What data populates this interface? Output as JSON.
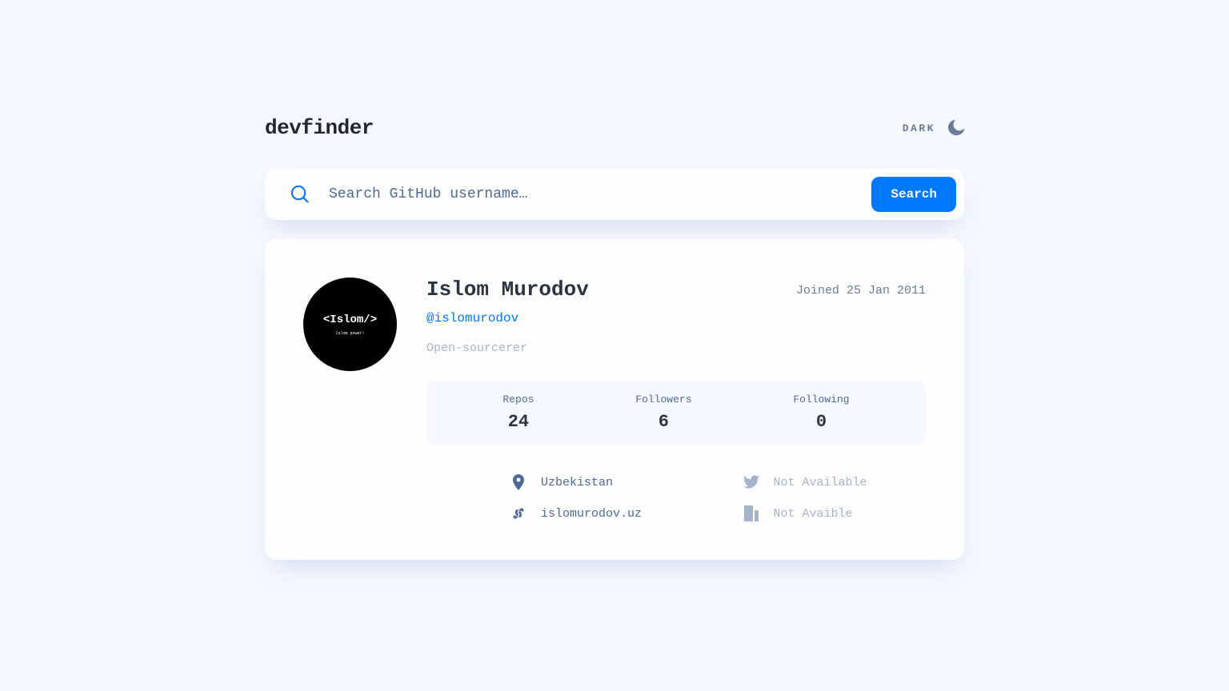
{
  "header": {
    "logo": "devfinder",
    "theme_label": "DARK"
  },
  "search": {
    "placeholder": "Search GitHub username…",
    "button_label": "Search"
  },
  "profile": {
    "avatar_text": "<Islom/>",
    "avatar_sub": "Islom power!",
    "name": "Islom Murodov",
    "join_date": "Joined 25 Jan 2011",
    "username": "@islomurodov",
    "bio": "Open-sourcerer",
    "stats": {
      "repos_label": "Repos",
      "repos_value": "24",
      "followers_label": "Followers",
      "followers_value": "6",
      "following_label": "Following",
      "following_value": "0"
    },
    "links": {
      "location": "Uzbekistan",
      "twitter": "Not Available",
      "website": "islomurodov.uz",
      "company": "Not Avaible"
    }
  }
}
